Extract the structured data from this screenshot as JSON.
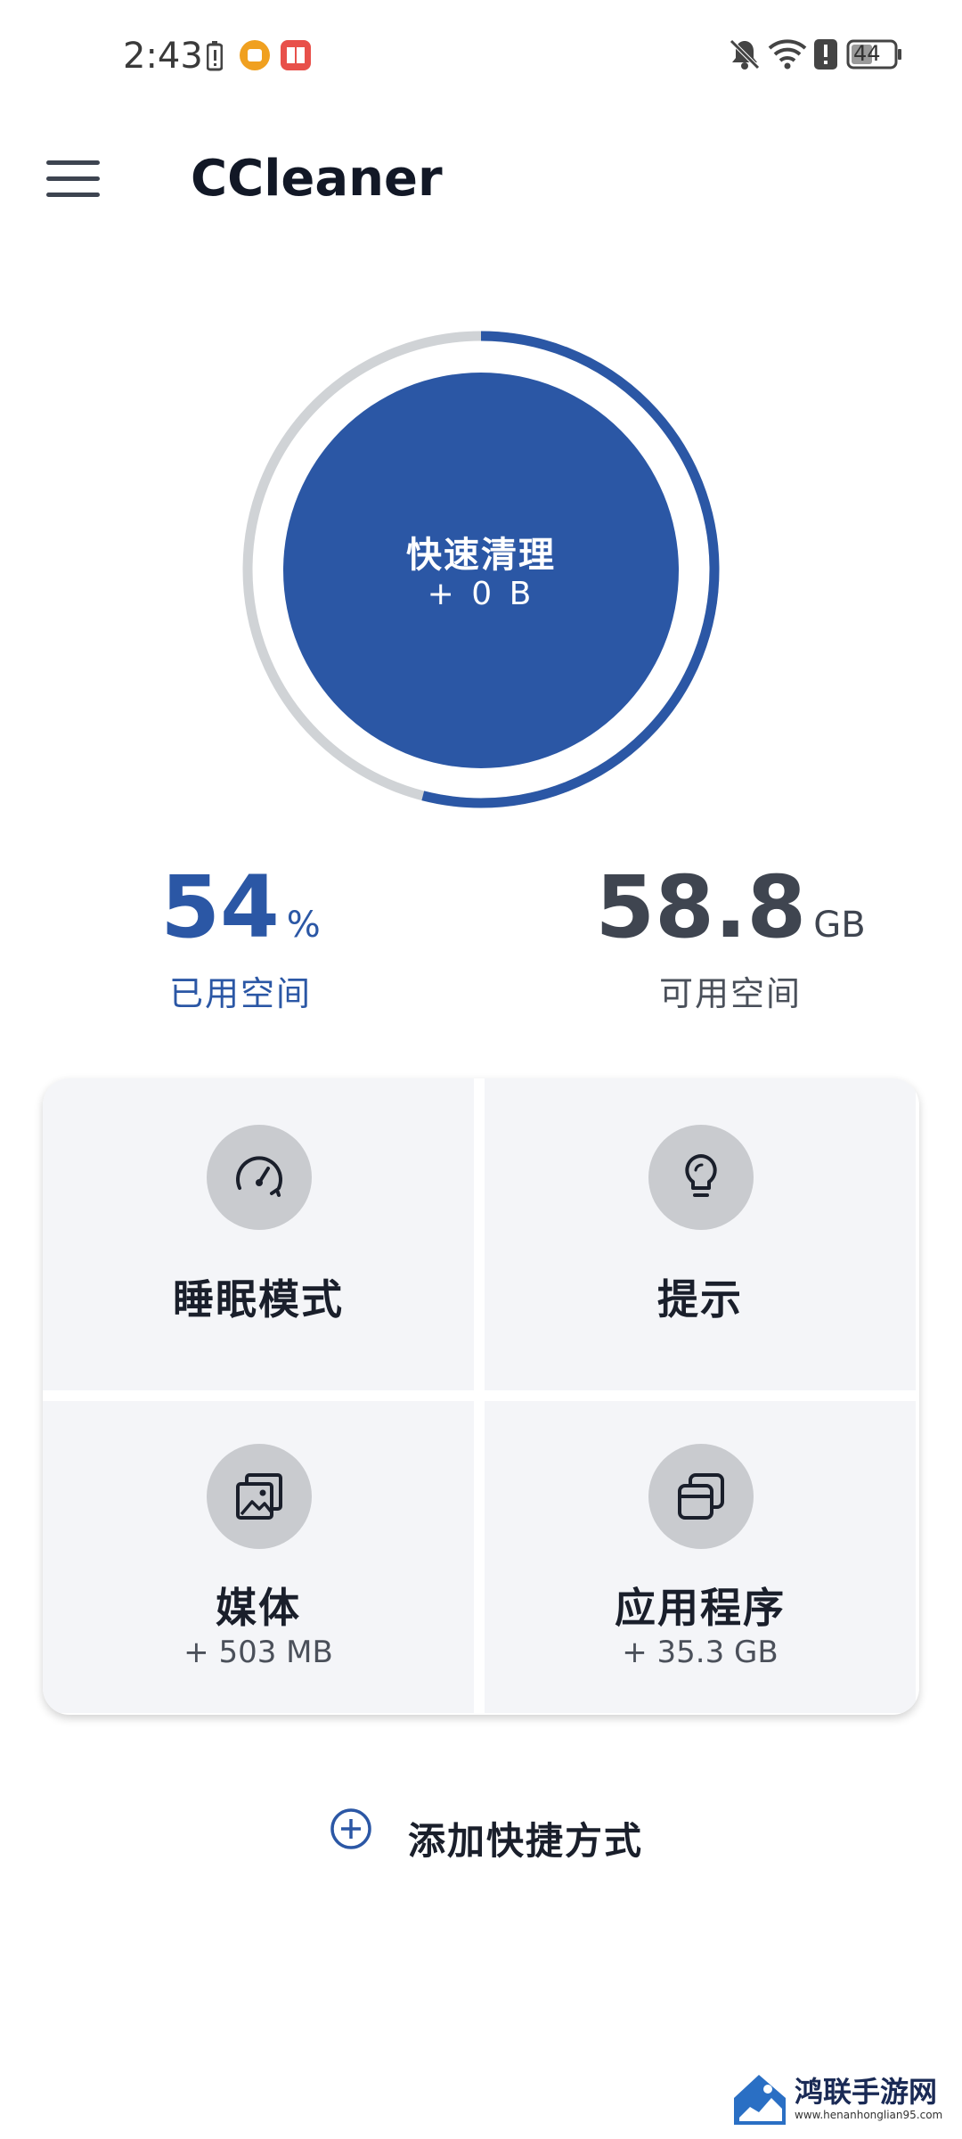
{
  "status_bar": {
    "time": "2:43",
    "battery": "44"
  },
  "header": {
    "title": "CCleaner"
  },
  "quick_clean": {
    "title": "快速清理",
    "size": "+ 0 B",
    "used_fraction": 0.54
  },
  "storage": {
    "used": {
      "value": "54",
      "unit": "%",
      "label": "已用空间"
    },
    "free": {
      "value": "58.8",
      "unit": "GB",
      "label": "可用空间"
    }
  },
  "tiles": [
    {
      "label": "睡眠模式",
      "icon": "speedometer-icon"
    },
    {
      "label": "提示",
      "icon": "lightbulb-icon"
    },
    {
      "label": "媒体",
      "sub": "+ 503 MB",
      "icon": "image-icon"
    },
    {
      "label": "应用程序",
      "sub": "+ 35.3 GB",
      "icon": "apps-icon"
    }
  ],
  "add_shortcut": {
    "label": "添加快捷方式"
  },
  "watermark": {
    "main": "鸿联手游网",
    "sub": "www.henanhonglian95.com"
  },
  "colors": {
    "accent": "#2b57a5",
    "ring_track": "#d0d3d6",
    "tile_bg": "#f4f5f8"
  }
}
